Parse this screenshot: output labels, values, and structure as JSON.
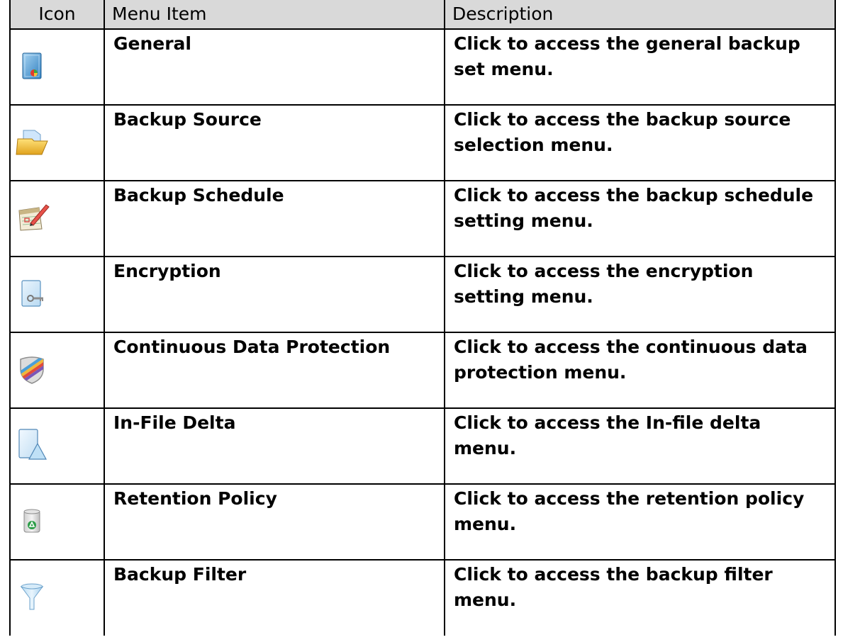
{
  "header": {
    "icon": "Icon",
    "menu_item": "Menu Item",
    "description": "Description"
  },
  "rows": [
    {
      "icon": "general-icon",
      "item": "General",
      "description": "Click to access the general backup set menu."
    },
    {
      "icon": "folder-icon",
      "item": "Backup Source",
      "description": "Click to access the backup source selection menu."
    },
    {
      "icon": "schedule-icon",
      "item": "Backup Schedule",
      "description": "Click to access the backup schedule setting menu."
    },
    {
      "icon": "encryption-key-icon",
      "item": "Encryption",
      "description": "Click to access the encryption setting menu."
    },
    {
      "icon": "shield-icon",
      "item": "Continuous Data Protection",
      "description": "Click to access the continuous data protection menu."
    },
    {
      "icon": "delta-icon",
      "item": "In-File Delta",
      "description": "Click to access the In-file delta menu."
    },
    {
      "icon": "recycle-bin-icon",
      "item": "Retention Policy",
      "description": "Click to access the retention policy menu."
    },
    {
      "icon": "filter-funnel-icon",
      "item": "Backup Filter",
      "description": "Click to access the backup filter menu."
    }
  ],
  "colors": {
    "header_background": "#d9d9d9",
    "border": "#000000"
  }
}
